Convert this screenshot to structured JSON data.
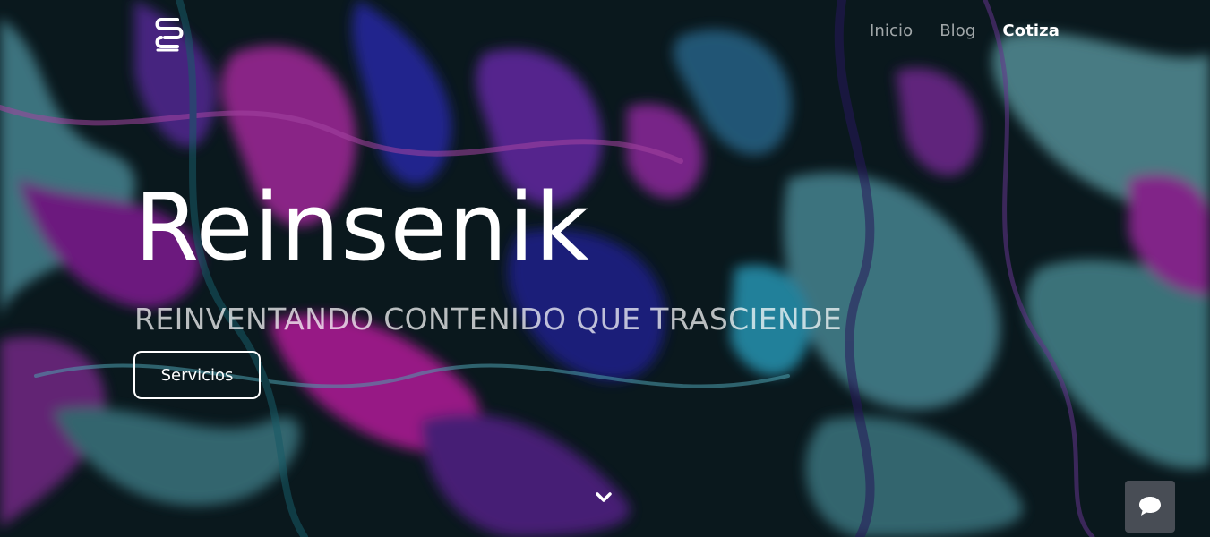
{
  "colors": {
    "text_primary": "#ffffff",
    "nav_inactive": "#a6a6b0",
    "chat_bg": "#4e525a",
    "bg_dark": "#0b1a1f",
    "bg_purple": "#8a1d9c",
    "bg_teal": "#4d8f9c",
    "bg_blue": "#2a2cb0"
  },
  "header": {
    "logo_icon": "s-logo-icon",
    "nav": {
      "items": [
        {
          "label": "Inicio",
          "active": false
        },
        {
          "label": "Blog",
          "active": false
        },
        {
          "label": "Cotiza",
          "active": true
        }
      ]
    }
  },
  "hero": {
    "title": "Reinsenik",
    "subtitle": "REINVENTANDO CONTENIDO QUE TRASCIENDE",
    "cta_label": "Servicios",
    "background": "abstract-liquid-marble-background",
    "scroll_icon": "chevron-down-icon"
  },
  "chat": {
    "icon": "chat-bubble-icon"
  }
}
